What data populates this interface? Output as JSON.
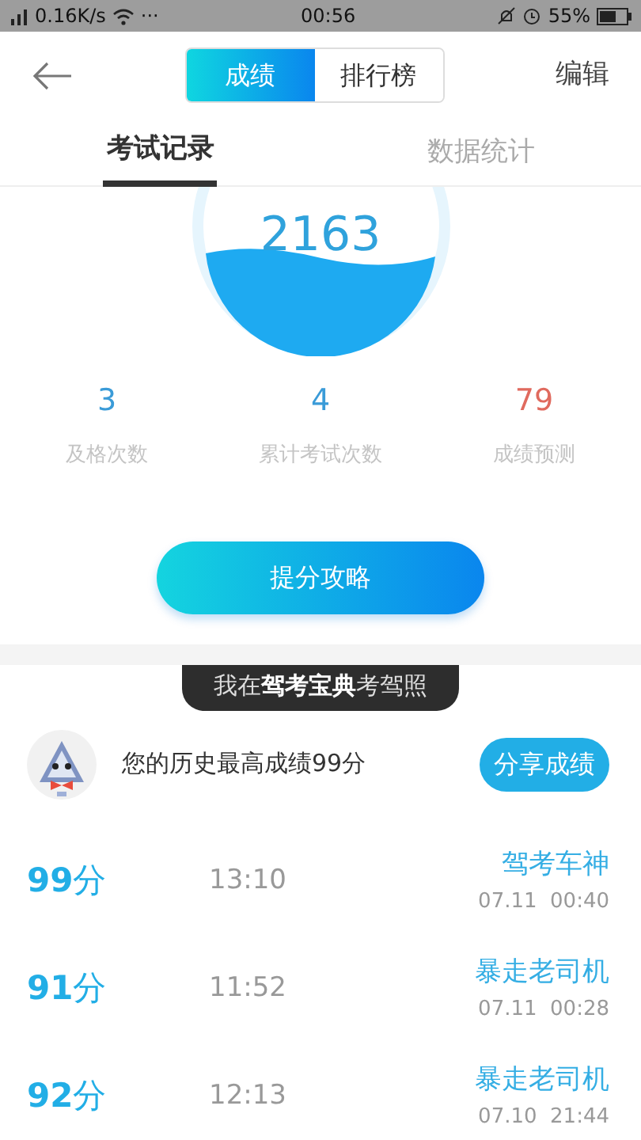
{
  "status_bar": {
    "speed": "0.16K/s",
    "dots": "···",
    "time": "00:56",
    "battery": "55%"
  },
  "header": {
    "segments": [
      {
        "label": "成绩",
        "selected": true
      },
      {
        "label": "排行榜",
        "selected": false
      }
    ],
    "action": "编辑"
  },
  "tabs": [
    {
      "label": "考试记录",
      "selected": true
    },
    {
      "label": "数据统计",
      "selected": false
    }
  ],
  "gauge": {
    "value": "2163"
  },
  "stats": [
    {
      "value": "3",
      "label": "及格次数",
      "color": "#3a9bd8"
    },
    {
      "value": "4",
      "label": "累计考试次数",
      "color": "#3a9bd8"
    },
    {
      "value": "79",
      "label": "成绩预测",
      "color": "#e06a5e"
    }
  ],
  "tips_button": "提分攻略",
  "banner": "我在**驾考宝典**考驾照",
  "best": {
    "text": "您的历史最高成绩99分",
    "share": "分享成绩"
  },
  "records": [
    {
      "score": "**99**分",
      "duration": "13:10",
      "title": "驾考车神",
      "date": "07.11  00:40"
    },
    {
      "score": "**91**分",
      "duration": "11:52",
      "title": "暴走老司机",
      "date": "07.11  00:28"
    },
    {
      "score": "**92**分",
      "duration": "12:13",
      "title": "暴走老司机",
      "date": "07.10  21:44"
    }
  ]
}
